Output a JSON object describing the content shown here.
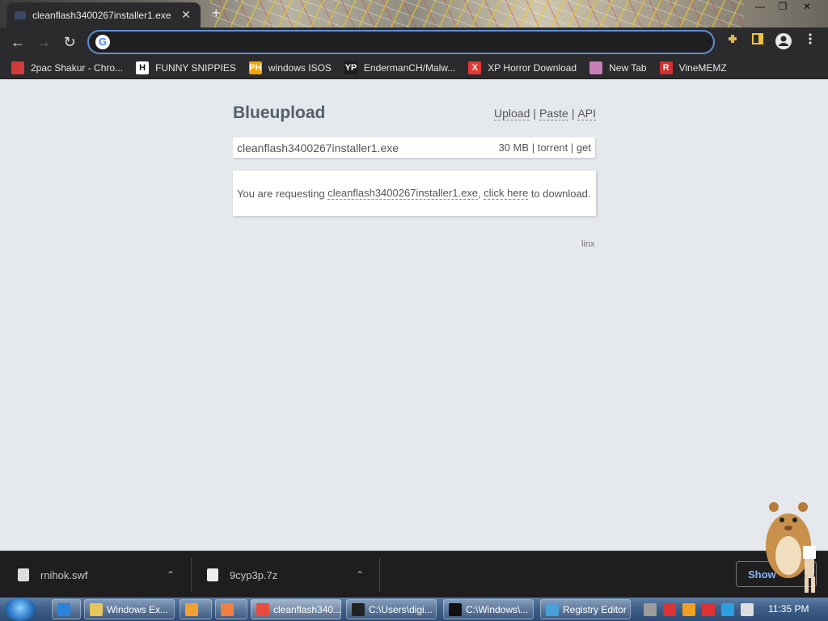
{
  "browser": {
    "tab_title": "cleanflash3400267installer1.exe",
    "tab_close": "✕",
    "new_tab": "+",
    "back_glyph": "←",
    "forward_glyph": "→",
    "reload_glyph": "↻",
    "google_glyph": "G",
    "address_value": "",
    "window_controls": [
      "—",
      "❐",
      "✕"
    ],
    "bookmarks": [
      {
        "label": "2pac Shakur - Chro...",
        "icon": "red-box-icon",
        "icon_text": "",
        "color": "#d23b3b"
      },
      {
        "label": "FUNNY SNIPPIES",
        "icon": "h-letter-icon",
        "icon_text": "H",
        "color": "#ffffff"
      },
      {
        "label": "windows ISOS",
        "icon": "ph-icon",
        "icon_text": "PH",
        "color": "#f7a400"
      },
      {
        "label": "EndermanCH/Malw...",
        "icon": "yp-icon",
        "icon_text": "YP",
        "color": "#1b1b1b"
      },
      {
        "label": "XP Horror Download",
        "icon": "x-icon",
        "icon_text": "X",
        "color": "#e53935"
      },
      {
        "label": "New Tab",
        "icon": "globe-icon",
        "icon_text": "",
        "color": "#c77fb7"
      },
      {
        "label": "VineMEMZ",
        "icon": "r-icon",
        "icon_text": "R",
        "color": "#d32f2f"
      }
    ]
  },
  "page": {
    "brand": "Blueupload",
    "nav": [
      "Upload",
      "Paste",
      "API"
    ],
    "nav_sep": "|",
    "file": {
      "name": "cleanflash3400267installer1.exe",
      "size": "30 MB",
      "torrent": "torrent",
      "get": "get",
      "sep": "|"
    },
    "request": {
      "prefix": "You are requesting ",
      "file_link": "cleanflash3400267installer1.exe",
      "comma": ", ",
      "click_here": "click here",
      "suffix": " to download."
    },
    "footer": "linx"
  },
  "downloads": {
    "items": [
      {
        "name": "rnihok.swf",
        "chevron": "⌃"
      },
      {
        "name": "9cyp3p.7z",
        "chevron": "⌃"
      }
    ],
    "show_all": "Show"
  },
  "taskbar": {
    "buttons": [
      {
        "label": "",
        "icon": "ie-icon",
        "color": "#2b82d9"
      },
      {
        "label": "Windows Ex...",
        "icon": "folder-icon",
        "color": "#e6c65a"
      },
      {
        "label": "",
        "icon": "media-player-icon",
        "color": "#f0a030"
      },
      {
        "label": "",
        "icon": "paint-icon",
        "color": "#f08040"
      },
      {
        "label": "cleanflash340...",
        "icon": "chrome-icon",
        "color": "#e84c3d"
      },
      {
        "label": "C:\\Users\\digi...",
        "icon": "7zip-icon",
        "color": "#222222"
      },
      {
        "label": "C:\\Windows\\...",
        "icon": "cmd-icon",
        "color": "#111111"
      },
      {
        "label": "Registry Editor",
        "icon": "regedit-icon",
        "color": "#4aa0d8"
      }
    ],
    "tray_icons": [
      "#9c9c9c",
      "#d33",
      "#f0a020",
      "#d33",
      "#2aa0e0",
      "#ddd"
    ],
    "clock": "11:35 PM"
  }
}
